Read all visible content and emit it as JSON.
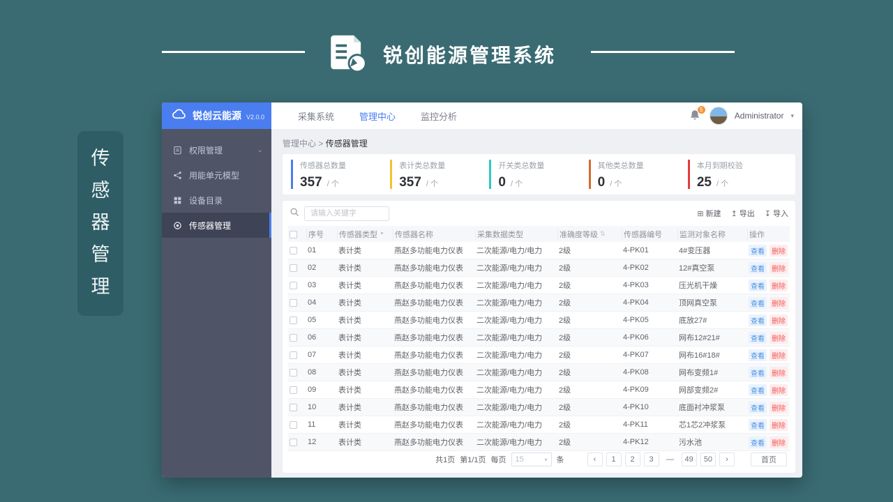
{
  "banner": {
    "title": "锐创能源管理系统"
  },
  "side_label": {
    "chars": [
      "传",
      "感",
      "器",
      "管",
      "理"
    ]
  },
  "app": {
    "logo": {
      "name": "锐创云能源",
      "version": "V2.0.0"
    },
    "nav": [
      {
        "label": "采集系统",
        "active": false
      },
      {
        "label": "管理中心",
        "active": true
      },
      {
        "label": "监控分析",
        "active": false
      }
    ],
    "user": {
      "name": "Administrator",
      "badge": "5",
      "caret": "▾"
    },
    "sidebar": [
      {
        "label": "权限管理",
        "icon": "clipboard",
        "expandable": true,
        "active": false
      },
      {
        "label": "用能单元模型",
        "icon": "nodes",
        "expandable": false,
        "active": false
      },
      {
        "label": "设备目录",
        "icon": "grid",
        "expandable": false,
        "active": false
      },
      {
        "label": "传感器管理",
        "icon": "sensor",
        "expandable": false,
        "active": true
      }
    ],
    "breadcrumb": {
      "root": "管理中心",
      "sep": ">",
      "current": "传感器管理"
    },
    "stats": [
      {
        "label": "传感器总数量",
        "value": "357",
        "unit": "/ 个",
        "color": "#4a7df0"
      },
      {
        "label": "表计类总数量",
        "value": "357",
        "unit": "/ 个",
        "color": "#f3c32e"
      },
      {
        "label": "开关类总数量",
        "value": "0",
        "unit": "/ 个",
        "color": "#2fc7c9"
      },
      {
        "label": "其他类总数量",
        "value": "0",
        "unit": "/ 个",
        "color": "#d96a2e"
      },
      {
        "label": "本月到期校验",
        "value": "25",
        "unit": "/ 个",
        "color": "#e23d3d"
      }
    ],
    "toolbar": {
      "search_placeholder": "请输入关键字",
      "new_label": "新建",
      "new_icon": "⊞",
      "export_label": "导出",
      "export_icon": "↥",
      "import_label": "导入",
      "import_icon": "↧",
      "filter_icon": "▼",
      "sort_icon": "⇅"
    },
    "table": {
      "headers": [
        "序号",
        "传感器类型",
        "传感器名称",
        "采集数据类型",
        "准确度等级",
        "传感器编号",
        "监测对象名称",
        "操作"
      ],
      "view_label": "查看",
      "delete_label": "删除",
      "rows": [
        {
          "no": "01",
          "type": "表计类",
          "name": "燕赵多功能电力仪表",
          "data_type": "二次能源/电力/电力",
          "accuracy": "2级",
          "code": "4-PK01",
          "target": "4#变压器"
        },
        {
          "no": "02",
          "type": "表计类",
          "name": "燕赵多功能电力仪表",
          "data_type": "二次能源/电力/电力",
          "accuracy": "2级",
          "code": "4-PK02",
          "target": "12#真空泵"
        },
        {
          "no": "03",
          "type": "表计类",
          "name": "燕赵多功能电力仪表",
          "data_type": "二次能源/电力/电力",
          "accuracy": "2级",
          "code": "4-PK03",
          "target": "压光机干燥"
        },
        {
          "no": "04",
          "type": "表计类",
          "name": "燕赵多功能电力仪表",
          "data_type": "二次能源/电力/电力",
          "accuracy": "2级",
          "code": "4-PK04",
          "target": "顶网真空泵"
        },
        {
          "no": "05",
          "type": "表计类",
          "name": "燕赵多功能电力仪表",
          "data_type": "二次能源/电力/电力",
          "accuracy": "2级",
          "code": "4-PK05",
          "target": "底放27#"
        },
        {
          "no": "06",
          "type": "表计类",
          "name": "燕赵多功能电力仪表",
          "data_type": "二次能源/电力/电力",
          "accuracy": "2级",
          "code": "4-PK06",
          "target": "网布12#21#"
        },
        {
          "no": "07",
          "type": "表计类",
          "name": "燕赵多功能电力仪表",
          "data_type": "二次能源/电力/电力",
          "accuracy": "2级",
          "code": "4-PK07",
          "target": "网布16#18#"
        },
        {
          "no": "08",
          "type": "表计类",
          "name": "燕赵多功能电力仪表",
          "data_type": "二次能源/电力/电力",
          "accuracy": "2级",
          "code": "4-PK08",
          "target": "网布变频1#"
        },
        {
          "no": "09",
          "type": "表计类",
          "name": "燕赵多功能电力仪表",
          "data_type": "二次能源/电力/电力",
          "accuracy": "2级",
          "code": "4-PK09",
          "target": "网部变频2#"
        },
        {
          "no": "10",
          "type": "表计类",
          "name": "燕赵多功能电力仪表",
          "data_type": "二次能源/电力/电力",
          "accuracy": "2级",
          "code": "4-PK10",
          "target": "底面衬冲浆泵"
        },
        {
          "no": "11",
          "type": "表计类",
          "name": "燕赵多功能电力仪表",
          "data_type": "二次能源/电力/电力",
          "accuracy": "2级",
          "code": "4-PK11",
          "target": "芯1芯2冲浆泵"
        },
        {
          "no": "12",
          "type": "表计类",
          "name": "燕赵多功能电力仪表",
          "data_type": "二次能源/电力/电力",
          "accuracy": "2级",
          "code": "4-PK12",
          "target": "污水池"
        }
      ]
    },
    "pagination": {
      "total": "共1页",
      "page": "第1/1页",
      "per_page_label": "每页",
      "per_page": "15",
      "per_page_caret": "▾",
      "unit": "条",
      "prev": "‹",
      "next": "›",
      "pages": [
        "1",
        "2",
        "3",
        "—",
        "49",
        "50"
      ],
      "home": "首页"
    }
  }
}
